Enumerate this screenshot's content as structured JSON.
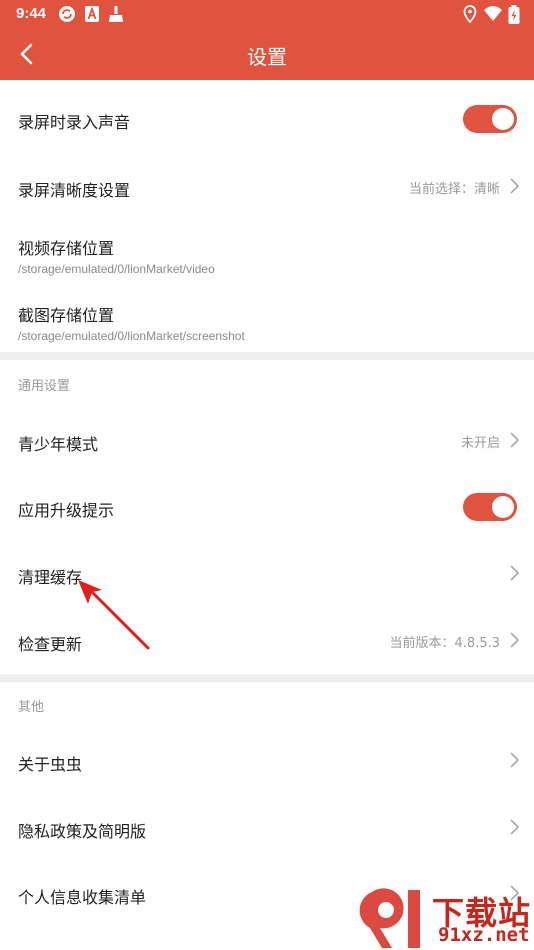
{
  "status_bar": {
    "time": "9:44",
    "left_icons": [
      "sync-icon",
      "a-badge-icon",
      "broom-icon"
    ],
    "right_icons": [
      "location-icon",
      "wifi-icon",
      "battery-charging-icon"
    ]
  },
  "app_bar": {
    "title": "设置",
    "back_icon": "chevron-left-icon"
  },
  "rows": {
    "record_audio": {
      "label": "录屏时录入声音",
      "toggle_on": true
    },
    "record_quality": {
      "label": "录屏清晰度设置",
      "value": "当前选择：清晰"
    },
    "video_storage": {
      "label": "视频存储位置",
      "path": "/storage/emulated/0/lionMarket/video"
    },
    "screenshot_storage": {
      "label": "截图存储位置",
      "path": "/storage/emulated/0/lionMarket/screenshot"
    },
    "teen_mode": {
      "label": "青少年模式",
      "value": "未开启"
    },
    "upgrade_notice": {
      "label": "应用升级提示",
      "toggle_on": true
    },
    "clear_cache": {
      "label": "清理缓存"
    },
    "check_update": {
      "label": "检查更新",
      "value": "当前版本：4.8.5.3"
    },
    "about": {
      "label": "关于虫虫"
    },
    "privacy": {
      "label": "隐私政策及简明版"
    },
    "personal_info": {
      "label": "个人信息收集清单"
    }
  },
  "sections": {
    "general": "通用设置",
    "other": "其他"
  },
  "annotation": {
    "icon": "red-arrow-icon",
    "color": "#e0201c"
  },
  "watermark": {
    "name": "下载站",
    "url": "91xz.net",
    "logo_icon": "91-logo-icon"
  },
  "colors": {
    "accent": "#e0533f",
    "divider": "#efefef",
    "secondary_text": "#9a9a9a"
  }
}
